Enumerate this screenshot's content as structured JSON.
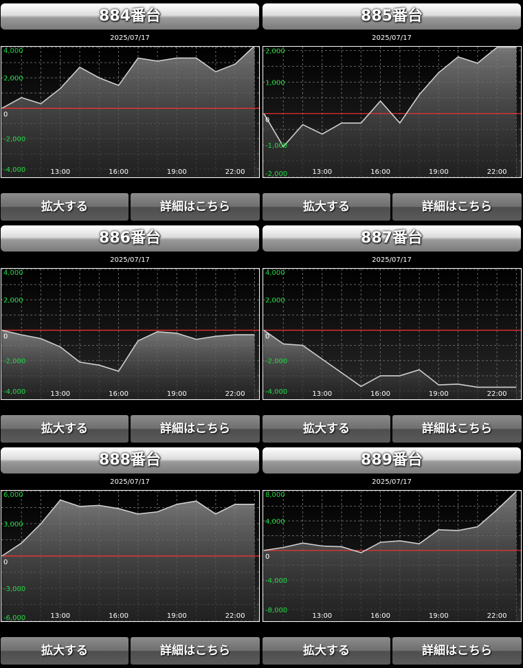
{
  "colors": {
    "grid": "#666666",
    "zero_line": "#ff3030",
    "series": "#d0d0d0",
    "axis_label_y": "#22dd44",
    "axis_label_x": "#ffffff"
  },
  "panels": [
    {
      "title": "884番台",
      "date": "2025/07/17",
      "zoom_label": "拡大する",
      "detail_label": "詳細はこちら",
      "chart_data": {
        "type": "area",
        "x": [
          "10:00",
          "11:00",
          "12:00",
          "13:00",
          "14:00",
          "15:00",
          "16:00",
          "17:00",
          "18:00",
          "19:00",
          "20:00",
          "21:00",
          "22:00",
          "23:00"
        ],
        "values": [
          0,
          700,
          300,
          1300,
          2700,
          2000,
          1500,
          3300,
          3100,
          3300,
          3300,
          2400,
          2900,
          4100
        ],
        "ylim": [
          -4500,
          4000
        ],
        "yticks": [
          4000,
          2000,
          0,
          -2000,
          -4000
        ],
        "ytick_labels": [
          "4,000",
          "2,000",
          "0",
          "-2,000",
          "-4,000"
        ],
        "xticks": [
          "13:00",
          "16:00",
          "19:00",
          "22:00"
        ],
        "xlim": [
          10,
          23.2
        ]
      }
    },
    {
      "title": "885番台",
      "date": "2025/07/17",
      "zoom_label": "拡大する",
      "detail_label": "詳細はこちら",
      "chart_data": {
        "type": "area",
        "x": [
          "10:00",
          "11:00",
          "12:00",
          "13:00",
          "14:00",
          "15:00",
          "16:00",
          "17:00",
          "18:00",
          "19:00",
          "20:00",
          "21:00",
          "22:00",
          "23:00"
        ],
        "values": [
          0,
          -1050,
          -350,
          -650,
          -300,
          -300,
          400,
          -300,
          600,
          1300,
          1800,
          1600,
          2100,
          2100
        ],
        "ylim": [
          -2000,
          2100
        ],
        "yticks": [
          2000,
          1000,
          0,
          -1000,
          -2000
        ],
        "ytick_labels": [
          "2,000",
          "1,000",
          "0",
          "-1,000",
          "-2,000"
        ],
        "xticks": [
          "13:00",
          "16:00",
          "19:00",
          "22:00"
        ],
        "xlim": [
          10,
          23.2
        ]
      }
    },
    {
      "title": "886番台",
      "date": "2025/07/17",
      "zoom_label": "拡大する",
      "detail_label": "詳細はこちら",
      "chart_data": {
        "type": "area",
        "x": [
          "10:00",
          "11:00",
          "12:00",
          "13:00",
          "14:00",
          "15:00",
          "16:00",
          "17:00",
          "18:00",
          "19:00",
          "20:00",
          "21:00",
          "22:00",
          "23:00"
        ],
        "values": [
          0,
          -300,
          -550,
          -1100,
          -2100,
          -2300,
          -2700,
          -700,
          -100,
          -200,
          -600,
          -400,
          -300,
          -300
        ],
        "ylim": [
          -4500,
          4000
        ],
        "yticks": [
          4000,
          2000,
          0,
          -2000,
          -4000
        ],
        "ytick_labels": [
          "4,000",
          "2,000",
          "0",
          "-2,000",
          "-4,000"
        ],
        "xticks": [
          "13:00",
          "16:00",
          "19:00",
          "22:00"
        ],
        "xlim": [
          10,
          23.2
        ]
      }
    },
    {
      "title": "887番台",
      "date": "2025/07/17",
      "zoom_label": "拡大する",
      "detail_label": "詳細はこちら",
      "chart_data": {
        "type": "area",
        "x": [
          "10:00",
          "11:00",
          "12:00",
          "13:00",
          "14:00",
          "15:00",
          "16:00",
          "17:00",
          "18:00",
          "19:00",
          "20:00",
          "21:00",
          "22:00",
          "23:00"
        ],
        "values": [
          0,
          -900,
          -1000,
          -1900,
          -2800,
          -3700,
          -3000,
          -3000,
          -2600,
          -3600,
          -3550,
          -3750,
          -3750,
          -3750
        ],
        "ylim": [
          -4500,
          4000
        ],
        "yticks": [
          4000,
          2000,
          0,
          -2000,
          -4000
        ],
        "ytick_labels": [
          "4,000",
          "2,000",
          "0",
          "-2,000",
          "-4,000"
        ],
        "xticks": [
          "13:00",
          "16:00",
          "19:00",
          "22:00"
        ],
        "xlim": [
          10,
          23.2
        ]
      }
    },
    {
      "title": "888番台",
      "date": "2025/07/17",
      "zoom_label": "拡大する",
      "detail_label": "詳細はこちら",
      "chart_data": {
        "type": "area",
        "x": [
          "10:00",
          "11:00",
          "12:00",
          "13:00",
          "14:00",
          "15:00",
          "16:00",
          "17:00",
          "18:00",
          "19:00",
          "20:00",
          "21:00",
          "22:00",
          "23:00"
        ],
        "values": [
          0,
          1200,
          3000,
          5200,
          4600,
          4700,
          4400,
          3900,
          4100,
          4800,
          5100,
          3900,
          4800,
          4800
        ],
        "ylim": [
          -6000,
          6000
        ],
        "yticks": [
          6000,
          3000,
          0,
          -3000,
          -6000
        ],
        "ytick_labels": [
          "6,000",
          "3,000",
          "0",
          "-3,000",
          "-6,000"
        ],
        "xticks": [
          "13:00",
          "16:00",
          "19:00",
          "22:00"
        ],
        "xlim": [
          10,
          23.2
        ]
      }
    },
    {
      "title": "889番台",
      "date": "2025/07/17",
      "zoom_label": "拡大する",
      "detail_label": "詳細はこちら",
      "chart_data": {
        "type": "area",
        "x": [
          "10:00",
          "11:00",
          "12:00",
          "13:00",
          "14:00",
          "15:00",
          "16:00",
          "17:00",
          "18:00",
          "19:00",
          "20:00",
          "21:00",
          "22:00",
          "23:00"
        ],
        "values": [
          0,
          400,
          1000,
          600,
          500,
          -300,
          1100,
          1300,
          900,
          2800,
          2700,
          3200,
          5500,
          8000
        ],
        "ylim": [
          -9500,
          8000
        ],
        "yticks": [
          8000,
          4000,
          0,
          -4000,
          -8000
        ],
        "ytick_labels": [
          "8,000",
          "4,000",
          "0",
          "-4,000",
          "-8,000"
        ],
        "xticks": [
          "13:00",
          "16:00",
          "19:00",
          "22:00"
        ],
        "xlim": [
          10,
          23.2
        ]
      }
    }
  ]
}
